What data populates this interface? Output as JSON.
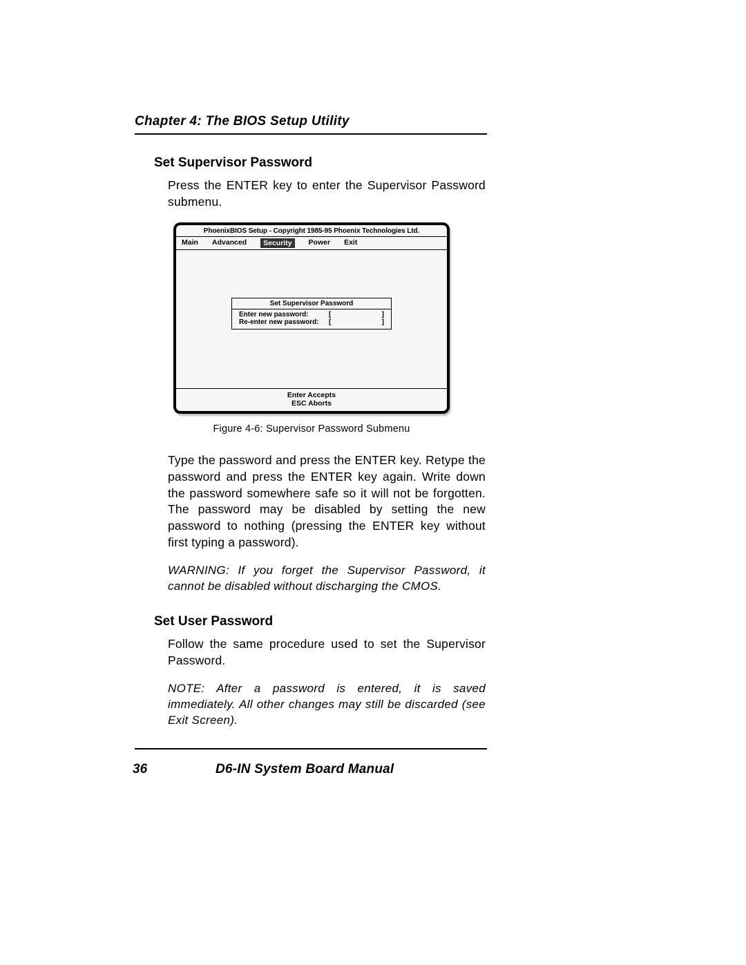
{
  "chapter_title": "Chapter 4: The BIOS Setup Utility",
  "section1": {
    "heading": "Set Supervisor Password",
    "intro": "Press the ENTER key to enter the Supervisor Password submenu.",
    "body": "Type the password and press the ENTER key. Retype the password and press the ENTER key again. Write down the password somewhere safe so it will not be forgotten. The password may be disabled by setting the new password to nothing (pressing the ENTER key without first typing a password).",
    "warning": "WARNING: If you forget the Supervisor Password, it cannot be disabled without discharging the CMOS."
  },
  "figure": {
    "bios_title": "PhoenixBIOS Setup - Copyright 1985-95 Phoenix Technologies Ltd.",
    "menu": [
      "Main",
      "Advanced",
      "Security",
      "Power",
      "Exit"
    ],
    "active_index": 2,
    "dialog_title": "Set Supervisor Password",
    "row1_label": "Enter new password:",
    "row2_label": "Re-enter new password:",
    "bracket_open": "[",
    "bracket_close": "]",
    "footer_line1": "Enter Accepts",
    "footer_line2": "ESC Aborts",
    "caption": "Figure 4-6: Supervisor Password Submenu"
  },
  "section2": {
    "heading": "Set User Password",
    "body": "Follow the same procedure used to set the Supervisor Password.",
    "note": "NOTE: After a password is entered, it is saved immediately. All other changes may still be discarded (see Exit Screen)."
  },
  "footer": {
    "page_number": "36",
    "title": "D6-IN System Board Manual"
  }
}
